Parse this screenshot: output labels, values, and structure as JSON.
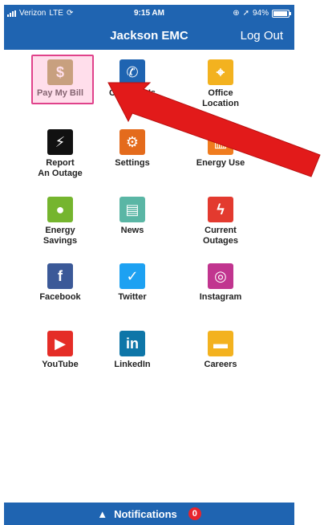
{
  "status_bar": {
    "carrier": "Verizon",
    "network": "LTE",
    "time": "9:15 AM",
    "battery": "94%",
    "battery_level": 0.94
  },
  "header": {
    "title": "Jackson EMC",
    "logout_label": "Log Out"
  },
  "tiles": [
    {
      "label": "Pay My Bill",
      "icon": "dollar-icon",
      "color": "#9b8f3b",
      "glyph": "$"
    },
    {
      "label": "Contact Us",
      "icon": "phone-icon",
      "color": "#1f64b1",
      "glyph": "✆"
    },
    {
      "label": "Office\nLocation",
      "icon": "location-pin-icon",
      "color": "#f3b21f",
      "glyph": "⌖"
    },
    {
      "label": "Report\nAn Outage",
      "icon": "plug-icon",
      "color": "#111111",
      "glyph": "⚡"
    },
    {
      "label": "Settings",
      "icon": "gears-icon",
      "color": "#e46b1c",
      "glyph": "⚙"
    },
    {
      "label": "Energy Use",
      "icon": "bar-chart-icon",
      "color": "#f07c1f",
      "glyph": "▥"
    },
    {
      "label": "Energy\nSavings",
      "icon": "piggy-bank-icon",
      "color": "#75b52e",
      "glyph": "●"
    },
    {
      "label": "News",
      "icon": "newspaper-icon",
      "color": "#5ab6a5",
      "glyph": "▤"
    },
    {
      "label": "Current\nOutages",
      "icon": "lightning-icon",
      "color": "#e33a2f",
      "glyph": "ϟ"
    },
    {
      "label": "Facebook",
      "icon": "facebook-icon",
      "color": "#3b5998",
      "glyph": "f"
    },
    {
      "label": "Twitter",
      "icon": "twitter-icon",
      "color": "#1da1f2",
      "glyph": "✓"
    },
    {
      "label": "Instagram",
      "icon": "instagram-icon",
      "color": "#c1358f",
      "glyph": "◎"
    },
    {
      "label": "YouTube",
      "icon": "youtube-icon",
      "color": "#e52d27",
      "glyph": "▶"
    },
    {
      "label": "LinkedIn",
      "icon": "linkedin-icon",
      "color": "#0e76a8",
      "glyph": "in"
    },
    {
      "label": "Careers",
      "icon": "briefcase-icon",
      "color": "#f3b21f",
      "glyph": "▬"
    }
  ],
  "notifications": {
    "label": "Notifications",
    "count": "0"
  }
}
